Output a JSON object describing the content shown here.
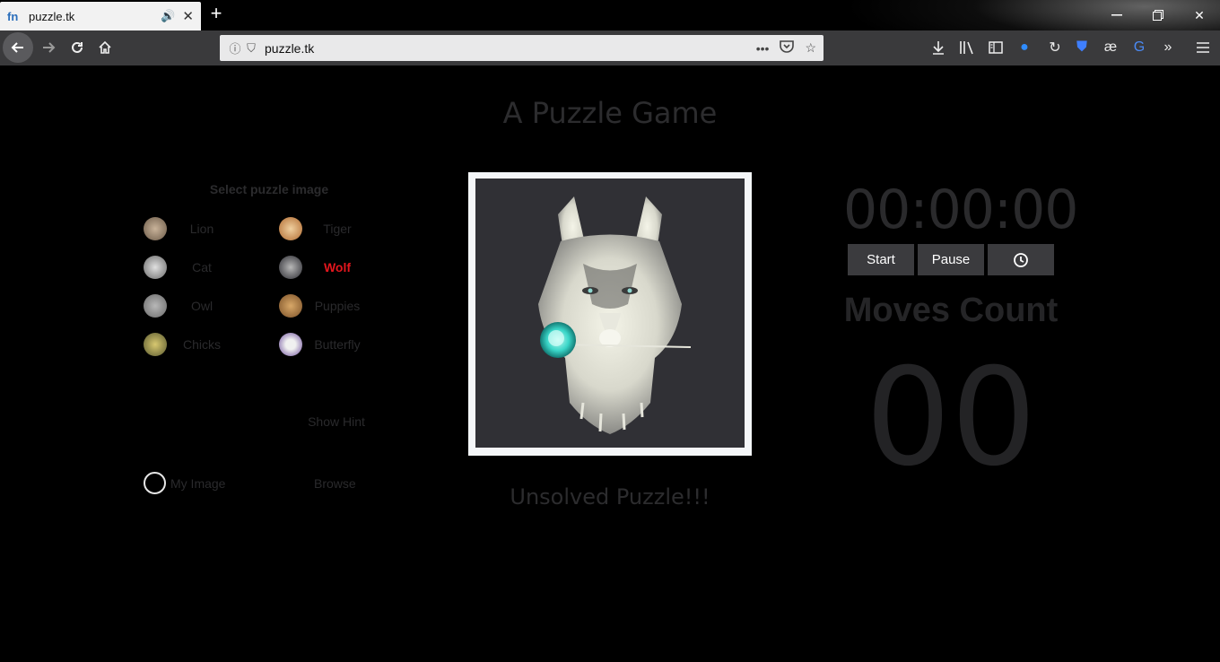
{
  "browser": {
    "tab_title": "puzzle.tk",
    "url": "puzzle.tk",
    "favicon_text": "fn",
    "icons": {
      "audio": "speaker-icon",
      "tab_close": "close-icon",
      "new_tab": "plus-icon",
      "back": "arrow-left-icon",
      "forward": "arrow-right-icon",
      "reload": "reload-icon",
      "home": "home-icon",
      "info": "info-icon",
      "shield": "shield-icon",
      "more": "ellipsis-icon",
      "pocket": "pocket-icon",
      "bookmark": "star-icon",
      "download": "download-icon",
      "library": "library-icon",
      "sidebar": "sidebar-icon",
      "menu": "hamburger-icon"
    },
    "extension_glyphs": [
      "✉",
      "↻",
      "⛊",
      "æ",
      "G",
      "»"
    ]
  },
  "page": {
    "title": "A Puzzle Game",
    "select_heading": "Select puzzle image",
    "options": [
      {
        "label": "Lion",
        "active": false,
        "color": "#8a7a6a"
      },
      {
        "label": "Tiger",
        "active": false,
        "color": "#b07840"
      },
      {
        "label": "Cat",
        "active": false,
        "color": "#9a9a9a"
      },
      {
        "label": "Wolf",
        "active": true,
        "color": "#4a4a50"
      },
      {
        "label": "Owl",
        "active": false,
        "color": "#8c8c8c"
      },
      {
        "label": "Puppies",
        "active": false,
        "color": "#b08850"
      },
      {
        "label": "Chicks",
        "active": false,
        "color": "#8a8a50"
      },
      {
        "label": "Butterfly",
        "active": false,
        "color": "#7a6a9a"
      }
    ],
    "show_hint": "Show Hint",
    "my_image": "My Image",
    "browse": "Browse",
    "status": "Unsolved Puzzle!!!",
    "timer": "00:00:00",
    "buttons": {
      "start": "Start",
      "pause": "Pause",
      "clock_icon": "clock-icon"
    },
    "moves_label": "Moves Count",
    "moves_value": "00",
    "colors": {
      "active_option": "#e3161d",
      "puzzle_bg": "#303035",
      "rose": "#3ad6c8"
    }
  }
}
